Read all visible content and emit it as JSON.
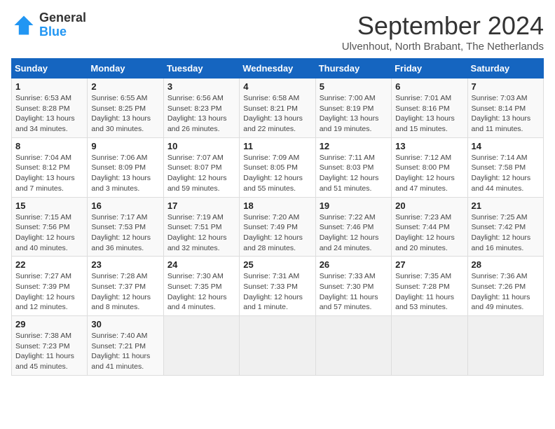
{
  "header": {
    "logo_general": "General",
    "logo_blue": "Blue",
    "month_title": "September 2024",
    "subtitle": "Ulvenhout, North Brabant, The Netherlands"
  },
  "days_of_week": [
    "Sunday",
    "Monday",
    "Tuesday",
    "Wednesday",
    "Thursday",
    "Friday",
    "Saturday"
  ],
  "weeks": [
    [
      {
        "day": "1",
        "info": "Sunrise: 6:53 AM\nSunset: 8:28 PM\nDaylight: 13 hours\nand 34 minutes."
      },
      {
        "day": "2",
        "info": "Sunrise: 6:55 AM\nSunset: 8:25 PM\nDaylight: 13 hours\nand 30 minutes."
      },
      {
        "day": "3",
        "info": "Sunrise: 6:56 AM\nSunset: 8:23 PM\nDaylight: 13 hours\nand 26 minutes."
      },
      {
        "day": "4",
        "info": "Sunrise: 6:58 AM\nSunset: 8:21 PM\nDaylight: 13 hours\nand 22 minutes."
      },
      {
        "day": "5",
        "info": "Sunrise: 7:00 AM\nSunset: 8:19 PM\nDaylight: 13 hours\nand 19 minutes."
      },
      {
        "day": "6",
        "info": "Sunrise: 7:01 AM\nSunset: 8:16 PM\nDaylight: 13 hours\nand 15 minutes."
      },
      {
        "day": "7",
        "info": "Sunrise: 7:03 AM\nSunset: 8:14 PM\nDaylight: 13 hours\nand 11 minutes."
      }
    ],
    [
      {
        "day": "8",
        "info": "Sunrise: 7:04 AM\nSunset: 8:12 PM\nDaylight: 13 hours\nand 7 minutes."
      },
      {
        "day": "9",
        "info": "Sunrise: 7:06 AM\nSunset: 8:09 PM\nDaylight: 13 hours\nand 3 minutes."
      },
      {
        "day": "10",
        "info": "Sunrise: 7:07 AM\nSunset: 8:07 PM\nDaylight: 12 hours\nand 59 minutes."
      },
      {
        "day": "11",
        "info": "Sunrise: 7:09 AM\nSunset: 8:05 PM\nDaylight: 12 hours\nand 55 minutes."
      },
      {
        "day": "12",
        "info": "Sunrise: 7:11 AM\nSunset: 8:03 PM\nDaylight: 12 hours\nand 51 minutes."
      },
      {
        "day": "13",
        "info": "Sunrise: 7:12 AM\nSunset: 8:00 PM\nDaylight: 12 hours\nand 47 minutes."
      },
      {
        "day": "14",
        "info": "Sunrise: 7:14 AM\nSunset: 7:58 PM\nDaylight: 12 hours\nand 44 minutes."
      }
    ],
    [
      {
        "day": "15",
        "info": "Sunrise: 7:15 AM\nSunset: 7:56 PM\nDaylight: 12 hours\nand 40 minutes."
      },
      {
        "day": "16",
        "info": "Sunrise: 7:17 AM\nSunset: 7:53 PM\nDaylight: 12 hours\nand 36 minutes."
      },
      {
        "day": "17",
        "info": "Sunrise: 7:19 AM\nSunset: 7:51 PM\nDaylight: 12 hours\nand 32 minutes."
      },
      {
        "day": "18",
        "info": "Sunrise: 7:20 AM\nSunset: 7:49 PM\nDaylight: 12 hours\nand 28 minutes."
      },
      {
        "day": "19",
        "info": "Sunrise: 7:22 AM\nSunset: 7:46 PM\nDaylight: 12 hours\nand 24 minutes."
      },
      {
        "day": "20",
        "info": "Sunrise: 7:23 AM\nSunset: 7:44 PM\nDaylight: 12 hours\nand 20 minutes."
      },
      {
        "day": "21",
        "info": "Sunrise: 7:25 AM\nSunset: 7:42 PM\nDaylight: 12 hours\nand 16 minutes."
      }
    ],
    [
      {
        "day": "22",
        "info": "Sunrise: 7:27 AM\nSunset: 7:39 PM\nDaylight: 12 hours\nand 12 minutes."
      },
      {
        "day": "23",
        "info": "Sunrise: 7:28 AM\nSunset: 7:37 PM\nDaylight: 12 hours\nand 8 minutes."
      },
      {
        "day": "24",
        "info": "Sunrise: 7:30 AM\nSunset: 7:35 PM\nDaylight: 12 hours\nand 4 minutes."
      },
      {
        "day": "25",
        "info": "Sunrise: 7:31 AM\nSunset: 7:33 PM\nDaylight: 12 hours\nand 1 minute."
      },
      {
        "day": "26",
        "info": "Sunrise: 7:33 AM\nSunset: 7:30 PM\nDaylight: 11 hours\nand 57 minutes."
      },
      {
        "day": "27",
        "info": "Sunrise: 7:35 AM\nSunset: 7:28 PM\nDaylight: 11 hours\nand 53 minutes."
      },
      {
        "day": "28",
        "info": "Sunrise: 7:36 AM\nSunset: 7:26 PM\nDaylight: 11 hours\nand 49 minutes."
      }
    ],
    [
      {
        "day": "29",
        "info": "Sunrise: 7:38 AM\nSunset: 7:23 PM\nDaylight: 11 hours\nand 45 minutes."
      },
      {
        "day": "30",
        "info": "Sunrise: 7:40 AM\nSunset: 7:21 PM\nDaylight: 11 hours\nand 41 minutes."
      },
      {
        "day": "",
        "info": ""
      },
      {
        "day": "",
        "info": ""
      },
      {
        "day": "",
        "info": ""
      },
      {
        "day": "",
        "info": ""
      },
      {
        "day": "",
        "info": ""
      }
    ]
  ]
}
